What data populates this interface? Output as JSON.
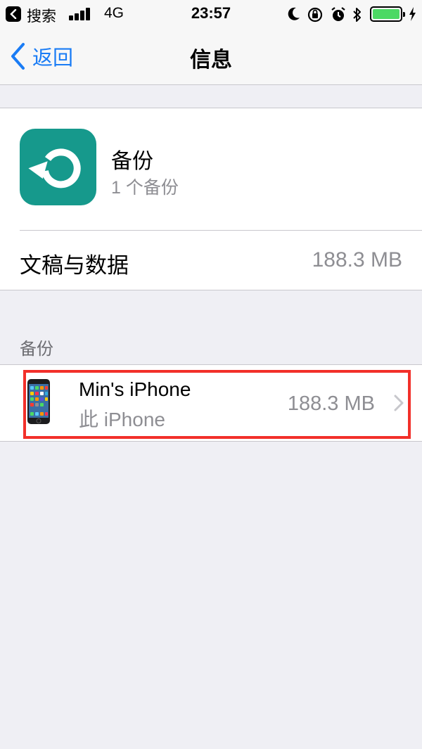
{
  "status_bar": {
    "back_app_label": "搜索",
    "network": "4G",
    "time": "23:57",
    "icons": [
      "moon-icon",
      "rotation-lock-icon",
      "alarm-icon",
      "bluetooth-icon",
      "battery-icon",
      "charging-icon"
    ]
  },
  "nav": {
    "back_label": "返回",
    "title": "信息"
  },
  "backup": {
    "title": "备份",
    "count": "1 个备份",
    "icon_color": "#16998c"
  },
  "docs": {
    "label": "文稿与数据",
    "value": "188.3 MB"
  },
  "backups_section": {
    "header": "备份",
    "items": [
      {
        "name": "Min's iPhone",
        "subtitle": "此 iPhone",
        "size": "188.3 MB"
      }
    ]
  },
  "colors": {
    "accent": "#1a7cf5",
    "highlight": "#f2302a",
    "battery": "#4cd964",
    "background": "#efeff4"
  }
}
